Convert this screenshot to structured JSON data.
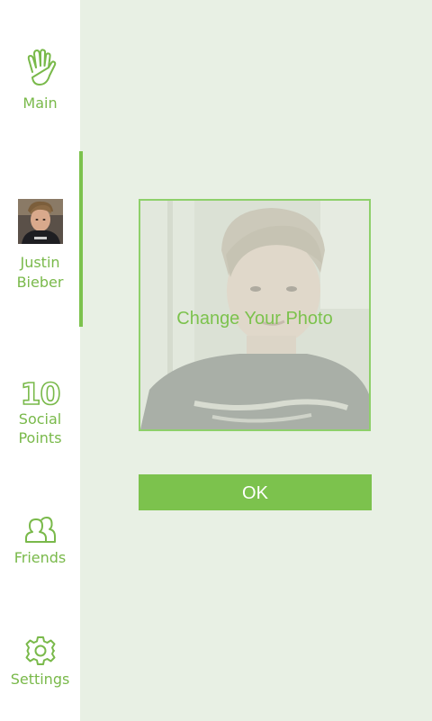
{
  "sidebar": {
    "main": {
      "label": "Main",
      "icon": "hand-icon"
    },
    "profile": {
      "label_line1": "Justin",
      "label_line2": "Bieber"
    },
    "points": {
      "value": "10",
      "label_line1": "Social",
      "label_line2": "Points"
    },
    "friends": {
      "label": "Friends",
      "icon": "friends-icon"
    },
    "settings": {
      "label": "Settings",
      "icon": "gear-icon"
    }
  },
  "photo": {
    "overlay_label": "Change Your Photo"
  },
  "ok_label": "OK",
  "colors": {
    "accent": "#7cc24d",
    "sidebar_bg": "#ffffff",
    "content_bg": "#e8f0e4"
  }
}
